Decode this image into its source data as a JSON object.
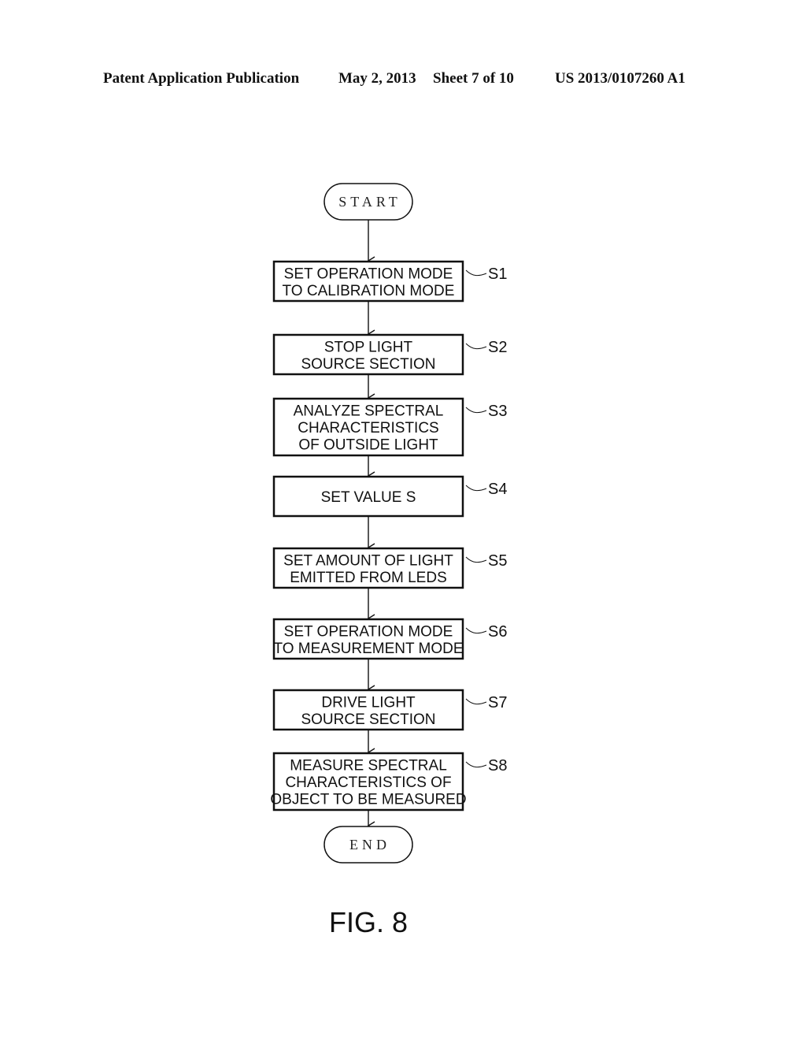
{
  "header": {
    "publication": "Patent Application Publication",
    "date": "May 2, 2013",
    "sheet": "Sheet 7 of 10",
    "number": "US 2013/0107260 A1"
  },
  "flowchart": {
    "start": "START",
    "end": "END",
    "steps": [
      {
        "id": "S1",
        "lines": [
          "SET OPERATION MODE",
          "TO CALIBRATION MODE"
        ]
      },
      {
        "id": "S2",
        "lines": [
          "STOP LIGHT",
          "SOURCE SECTION"
        ]
      },
      {
        "id": "S3",
        "lines": [
          "ANALYZE SPECTRAL",
          "CHARACTERISTICS",
          "OF OUTSIDE LIGHT"
        ]
      },
      {
        "id": "S4",
        "lines": [
          "SET VALUE S"
        ]
      },
      {
        "id": "S5",
        "lines": [
          "SET AMOUNT OF LIGHT",
          "EMITTED FROM LEDS"
        ]
      },
      {
        "id": "S6",
        "lines": [
          "SET OPERATION MODE",
          "TO MEASUREMENT MODE"
        ]
      },
      {
        "id": "S7",
        "lines": [
          "DRIVE LIGHT",
          "SOURCE SECTION"
        ]
      },
      {
        "id": "S8",
        "lines": [
          "MEASURE SPECTRAL",
          "CHARACTERISTICS OF",
          "OBJECT TO BE MEASURED"
        ]
      }
    ]
  },
  "figure_label": "FIG. 8"
}
